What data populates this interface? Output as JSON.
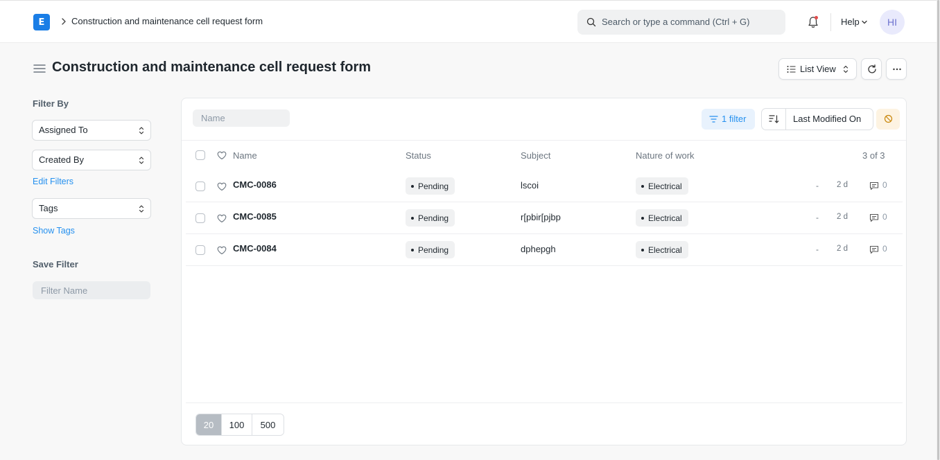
{
  "navbar": {
    "logo_letter": "E",
    "breadcrumb": "Construction and maintenance cell request form",
    "search_placeholder": "Search or type a command (Ctrl + G)",
    "help_label": "Help",
    "avatar_initials": "HI"
  },
  "page": {
    "title": "Construction and maintenance cell request form",
    "view_label": "List View"
  },
  "sidebar": {
    "filter_by_label": "Filter By",
    "assigned_to_label": "Assigned To",
    "created_by_label": "Created By",
    "edit_filters_label": "Edit Filters",
    "tags_label": "Tags",
    "show_tags_label": "Show Tags",
    "save_filter_label": "Save Filter",
    "filter_name_placeholder": "Filter Name"
  },
  "toolbar": {
    "name_placeholder": "Name",
    "filter_label": "1 filter",
    "sort_label": "Last Modified On"
  },
  "table": {
    "columns": [
      "Name",
      "Status",
      "Subject",
      "Nature of work"
    ],
    "count_label": "3 of 3",
    "rows": [
      {
        "name": "CMC-0086",
        "status": "Pending",
        "subject": "lscoi",
        "nature": "Electrical",
        "assigned": "-",
        "age": "2 d",
        "comments": "0"
      },
      {
        "name": "CMC-0085",
        "status": "Pending",
        "subject": "r[pbir[pjbp",
        "nature": "Electrical",
        "assigned": "-",
        "age": "2 d",
        "comments": "0"
      },
      {
        "name": "CMC-0084",
        "status": "Pending",
        "subject": "dphepgh",
        "nature": "Electrical",
        "assigned": "-",
        "age": "2 d",
        "comments": "0"
      }
    ]
  },
  "pagination": {
    "options": [
      "20",
      "100",
      "500"
    ],
    "selected": "20"
  },
  "colors": {
    "accent": "#2490ef",
    "logo_bg": "#1a7ee6",
    "active_page": "#b6bcc3",
    "notification_dot": "#e24c4c"
  },
  "icons": [
    "logo-icon",
    "chevron-right-icon",
    "search-icon",
    "bell-icon",
    "chevron-down-icon",
    "hamburger-icon",
    "list-icon",
    "sort-arrows-icon",
    "refresh-icon",
    "more-icon",
    "filter-icon",
    "sort-direction-icon",
    "clear-sort-icon",
    "heart-icon",
    "comment-icon"
  ]
}
